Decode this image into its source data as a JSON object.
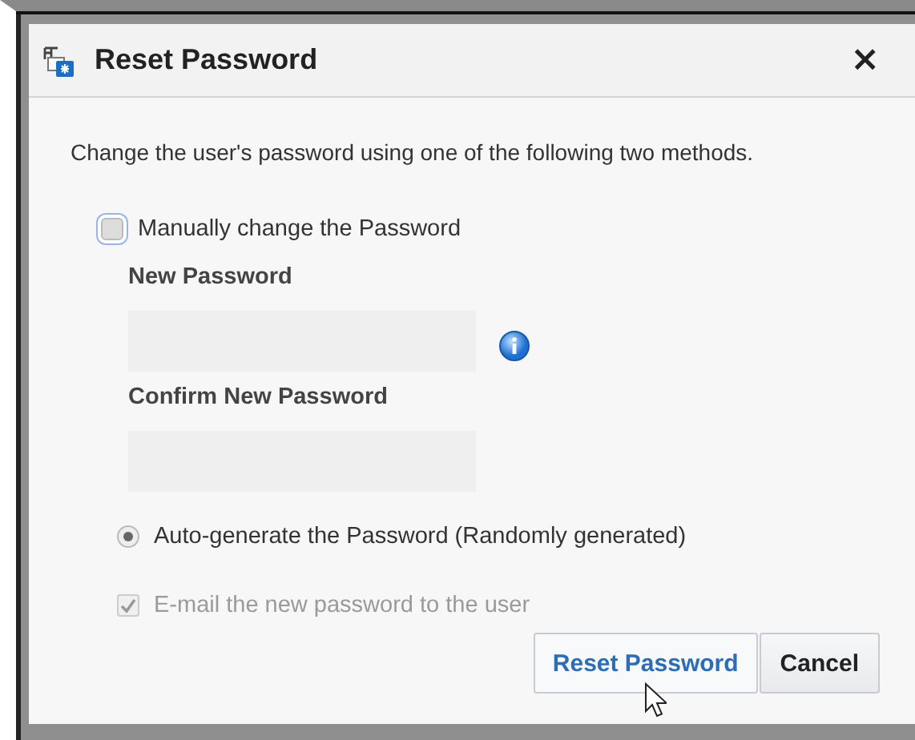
{
  "dialog": {
    "title": "Reset Password",
    "close": "×",
    "description": "Change the user's password using one of the following two methods.",
    "methods": [
      {
        "kind": "manual",
        "label": "Manually change the Password",
        "selected": false,
        "focused": true,
        "fields": [
          {
            "label": "New Password",
            "disabled": true,
            "info": true
          },
          {
            "label": "Confirm New Password",
            "disabled": true,
            "info": false
          }
        ]
      },
      {
        "kind": "auto",
        "label": "Auto-generate the Password (Randomly generated)",
        "selected": true
      }
    ],
    "email": {
      "label": "E-mail the new password to the user",
      "checked": true,
      "disabled": true
    },
    "buttons": [
      {
        "label": "Reset Password",
        "primary": true
      },
      {
        "label": "Cancel",
        "primary": false
      }
    ]
  }
}
